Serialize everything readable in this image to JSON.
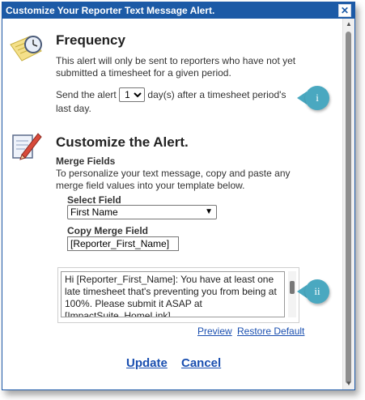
{
  "dialog": {
    "title": "Customize Your Reporter Text Message Alert.",
    "close_symbol": "✕"
  },
  "frequency": {
    "title": "Frequency",
    "description": "This alert will only be sent to reporters who have not yet submitted a timesheet for a given period.",
    "send_prefix": "Send the alert",
    "days_value": "1",
    "send_suffix": "day(s) after a timesheet period's last day.",
    "badge": "i"
  },
  "customize": {
    "title": "Customize the Alert.",
    "merge_heading": "Merge Fields",
    "merge_description": "To personalize your text message, copy and paste any merge field values into your template below.",
    "select_label": "Select Field",
    "select_value": "First Name",
    "copy_label": "Copy Merge Field",
    "copy_value": "[Reporter_First_Name]",
    "template": "Hi [Reporter_First_Name]: You have at least one late timesheet that's preventing you from being at 100%. Please submit it ASAP at [ImpactSuite_HomeLink].",
    "badge": "ii",
    "preview_label": "Preview",
    "restore_label": "Restore Default"
  },
  "actions": {
    "update_label": "Update",
    "cancel_label": "Cancel"
  },
  "icons": {
    "frequency": "clock-icon",
    "customize": "edit-pencil-icon"
  }
}
